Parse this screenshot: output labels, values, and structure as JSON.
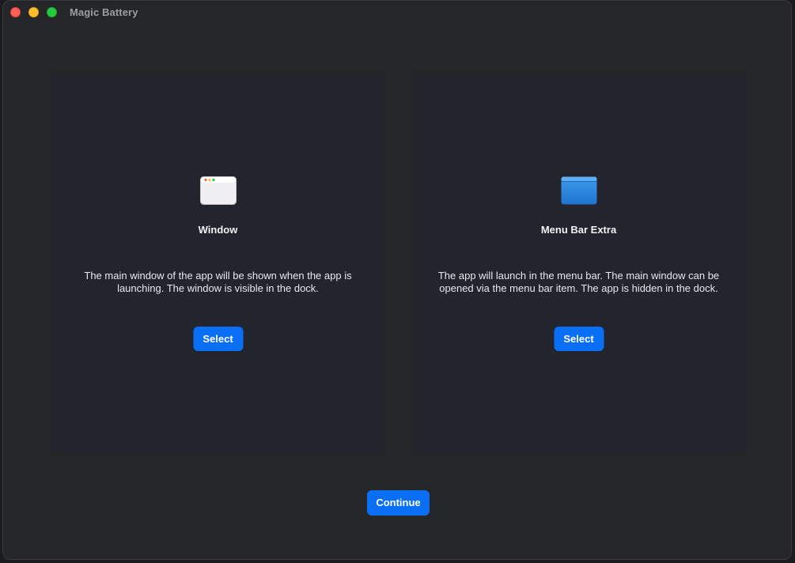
{
  "window": {
    "title": "Magic Battery"
  },
  "options": [
    {
      "icon": "app-window-icon",
      "title": "Window",
      "description": "The main window of the app will be shown when the app is launching. The window is visible in the dock.",
      "button_label": "Select"
    },
    {
      "icon": "menu-bar-window-icon",
      "title": "Menu Bar Extra",
      "description": "The app will launch in the menu bar. The main window can be opened via the menu bar item. The app is hidden in the dock.",
      "button_label": "Select"
    }
  ],
  "footer": {
    "continue_label": "Continue"
  },
  "colors": {
    "accent": "#0a6ff5",
    "window_background": "#252627",
    "card_background": "#23252e",
    "close": "#ff5f57",
    "minimize": "#febc2e",
    "zoom": "#28c840"
  }
}
